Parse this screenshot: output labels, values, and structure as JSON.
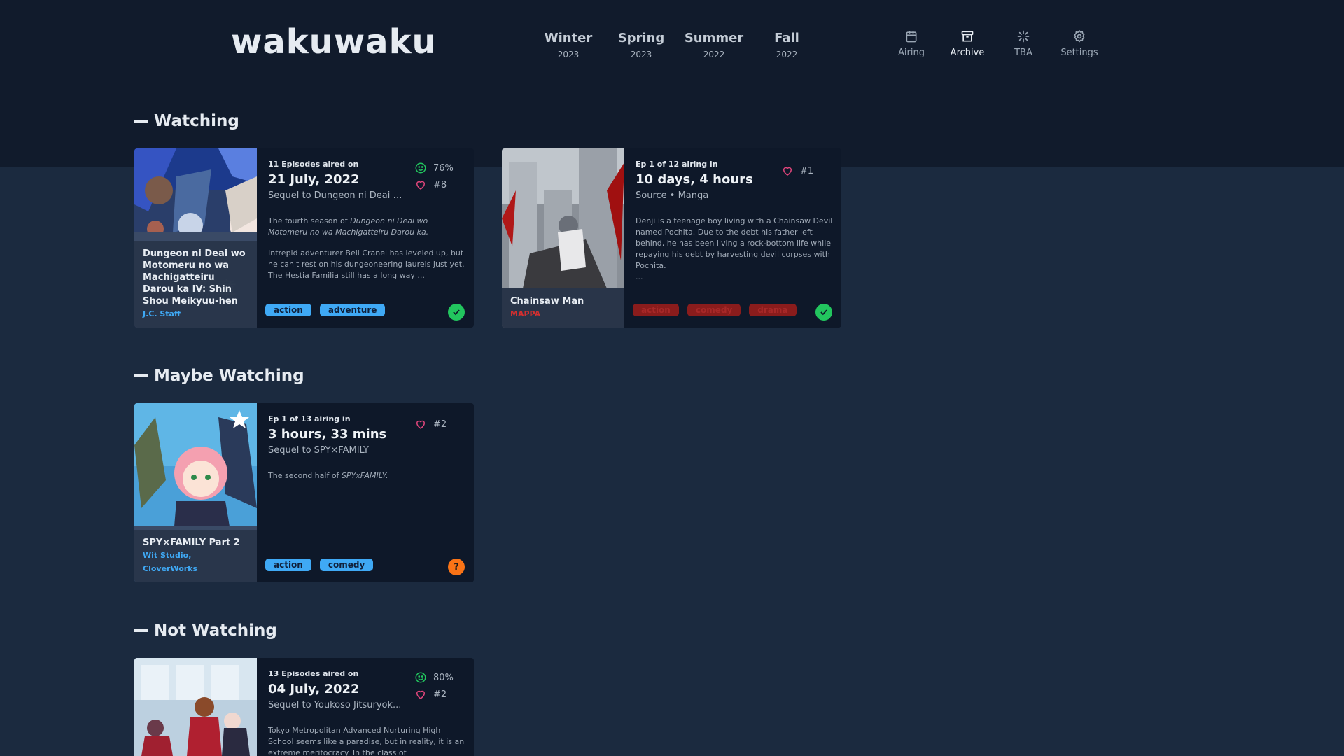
{
  "app": {
    "logo": "wakuwaku"
  },
  "seasons": [
    {
      "name": "Winter",
      "year": "2023"
    },
    {
      "name": "Spring",
      "year": "2023"
    },
    {
      "name": "Summer",
      "year": "2022"
    },
    {
      "name": "Fall",
      "year": "2022"
    }
  ],
  "nav": [
    {
      "label": "Airing",
      "icon": "calendar-icon"
    },
    {
      "label": "Archive",
      "icon": "archive-icon",
      "active": true
    },
    {
      "label": "TBA",
      "icon": "loader-icon"
    },
    {
      "label": "Settings",
      "icon": "gear-icon"
    }
  ],
  "sections": {
    "watching": "Watching",
    "maybe": "Maybe Watching",
    "not": "Not Watching"
  },
  "colors": {
    "accent_blue": "#3fa9f5",
    "status_green": "#22c55e",
    "status_orange": "#f97316",
    "heart_pink": "#e0457b",
    "tag_red": "#8a1c1c"
  },
  "cards": {
    "danmachi": {
      "pre": "11 Episodes aired on",
      "big": "21 July, 2022",
      "sub": "Sequel to Dungeon ni Deai w...",
      "desc1_pre": "The fourth season of ",
      "desc1_em": "Dungeon ni Deai wo Motomeru no wa Machigatteiru Darou ka.",
      "desc2": "Intrepid adventurer Bell Cranel has leveled up, but he can't rest on his dungeoneering laurels just yet. The Hestia Familia still has a long way ...",
      "score": "76%",
      "rank": "#8",
      "title": "Dungeon ni Deai wo Motomeru no wa Machigatteiru Darou ka IV: Shin Shou Meikyuu-hen",
      "studio": "J.C. Staff",
      "tags": [
        "action",
        "adventure"
      ]
    },
    "chainsaw": {
      "pre": "Ep 1 of 12 airing in",
      "big": "10 days, 4 hours",
      "sub": "Source • Manga",
      "desc": "Denji is a teenage boy living with a Chainsaw Devil named Pochita. Due to the debt his father left behind, he has been living a rock-bottom life while repaying his debt by harvesting devil corpses with Pochita.",
      "desc_more": "...",
      "rank": "#1",
      "title": "Chainsaw Man",
      "studio": "MAPPA",
      "tags": [
        "action",
        "comedy",
        "drama"
      ]
    },
    "spy": {
      "pre": "Ep 1 of 13 airing in",
      "big": "3 hours, 33 mins",
      "sub": "Sequel to SPY×FAMILY",
      "desc_pre": "The second half of ",
      "desc_em": "SPYxFAMILY.",
      "rank": "#2",
      "title": "SPY×FAMILY Part 2",
      "studio1": "Wit Studio,",
      "studio2": "CloverWorks",
      "tags": [
        "action",
        "comedy"
      ],
      "status": "?"
    },
    "cote": {
      "pre": "13 Episodes aired on",
      "big": "04 July, 2022",
      "sub": "Sequel to Youkoso Jitsuryok...",
      "desc": "Tokyo Metropolitan Advanced Nurturing High School seems like a paradise, but in reality, it is an extreme meritocracy. In the class of",
      "score": "80%",
      "rank": "#2"
    }
  }
}
